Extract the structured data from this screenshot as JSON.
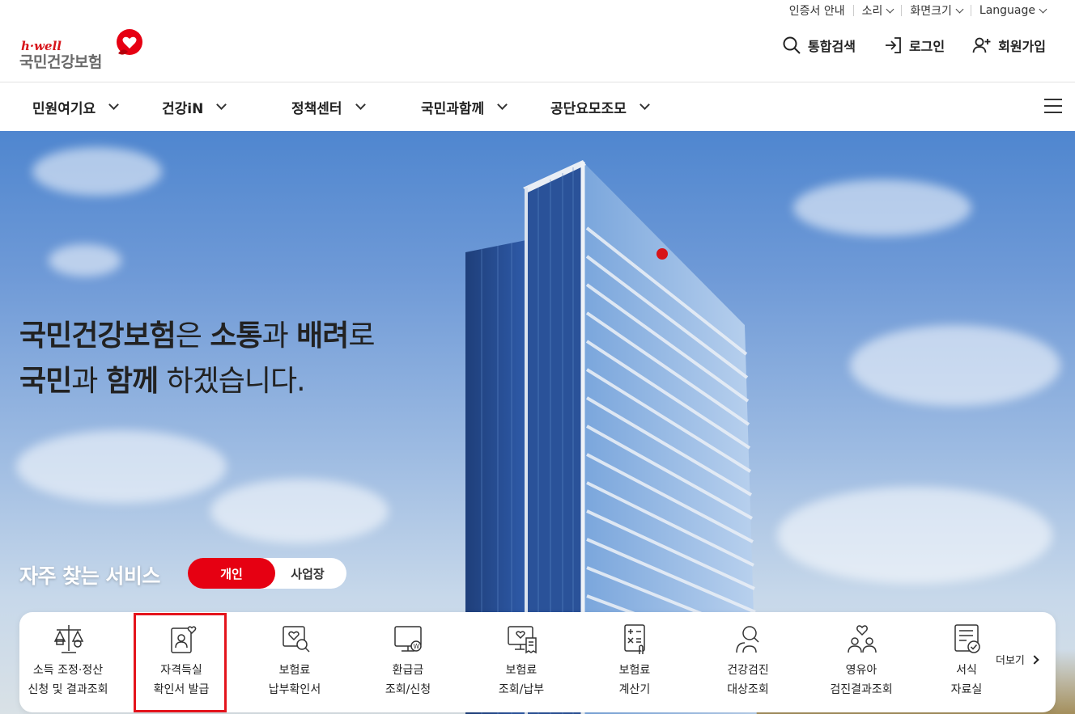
{
  "utility": {
    "items": [
      {
        "label": "인증서 안내"
      },
      {
        "label": "소리"
      },
      {
        "label": "화면크기"
      },
      {
        "label": "Language"
      }
    ]
  },
  "logo": {
    "hwell": "h·well",
    "name": "국민건강보험"
  },
  "header": {
    "search_label": "통합검색",
    "login_label": "로그인",
    "signup_label": "회원가입"
  },
  "nav": {
    "items": [
      {
        "label": "민원여기요"
      },
      {
        "label": "건강iN"
      },
      {
        "label": "정책센터"
      },
      {
        "label": "국민과함께"
      },
      {
        "label": "공단요모조모"
      }
    ]
  },
  "hero": {
    "line1": {
      "b1": "국민건강보험",
      "t1": "은 ",
      "b2": "소통",
      "t2": "과 ",
      "b3": "배려",
      "t3": "로"
    },
    "line2": {
      "b1": "국민",
      "t1": "과 ",
      "b2": "함께",
      "t2": " 하겠습니다."
    }
  },
  "frequent": {
    "title": "자주 찾는 서비스",
    "tab_personal": "개인",
    "tab_business": "사업장",
    "more_label": "더보기",
    "services": [
      {
        "icon": "scale-icon",
        "line1": "소득 조정·정산",
        "line2": "신청 및 결과조회"
      },
      {
        "icon": "id-card-heart-icon",
        "line1": "자격득실",
        "line2": "확인서 발급"
      },
      {
        "icon": "document-search-icon",
        "line1": "보험료",
        "line2": "납부확인서"
      },
      {
        "icon": "monitor-won-icon",
        "line1": "환급금",
        "line2": "조회/신청"
      },
      {
        "icon": "monitor-receipt-icon",
        "line1": "보험료",
        "line2": "조회/납부"
      },
      {
        "icon": "calculator-icon",
        "line1": "보험료",
        "line2": "계산기"
      },
      {
        "icon": "person-search-icon",
        "line1": "건강검진",
        "line2": "대상조회"
      },
      {
        "icon": "family-heart-icon",
        "line1": "영유아",
        "line2": "검진결과조회"
      },
      {
        "icon": "form-check-icon",
        "line1": "서식",
        "line2": "자료실"
      }
    ]
  },
  "colors": {
    "brand_red": "#e60012",
    "highlight_red": "#e4141c"
  }
}
